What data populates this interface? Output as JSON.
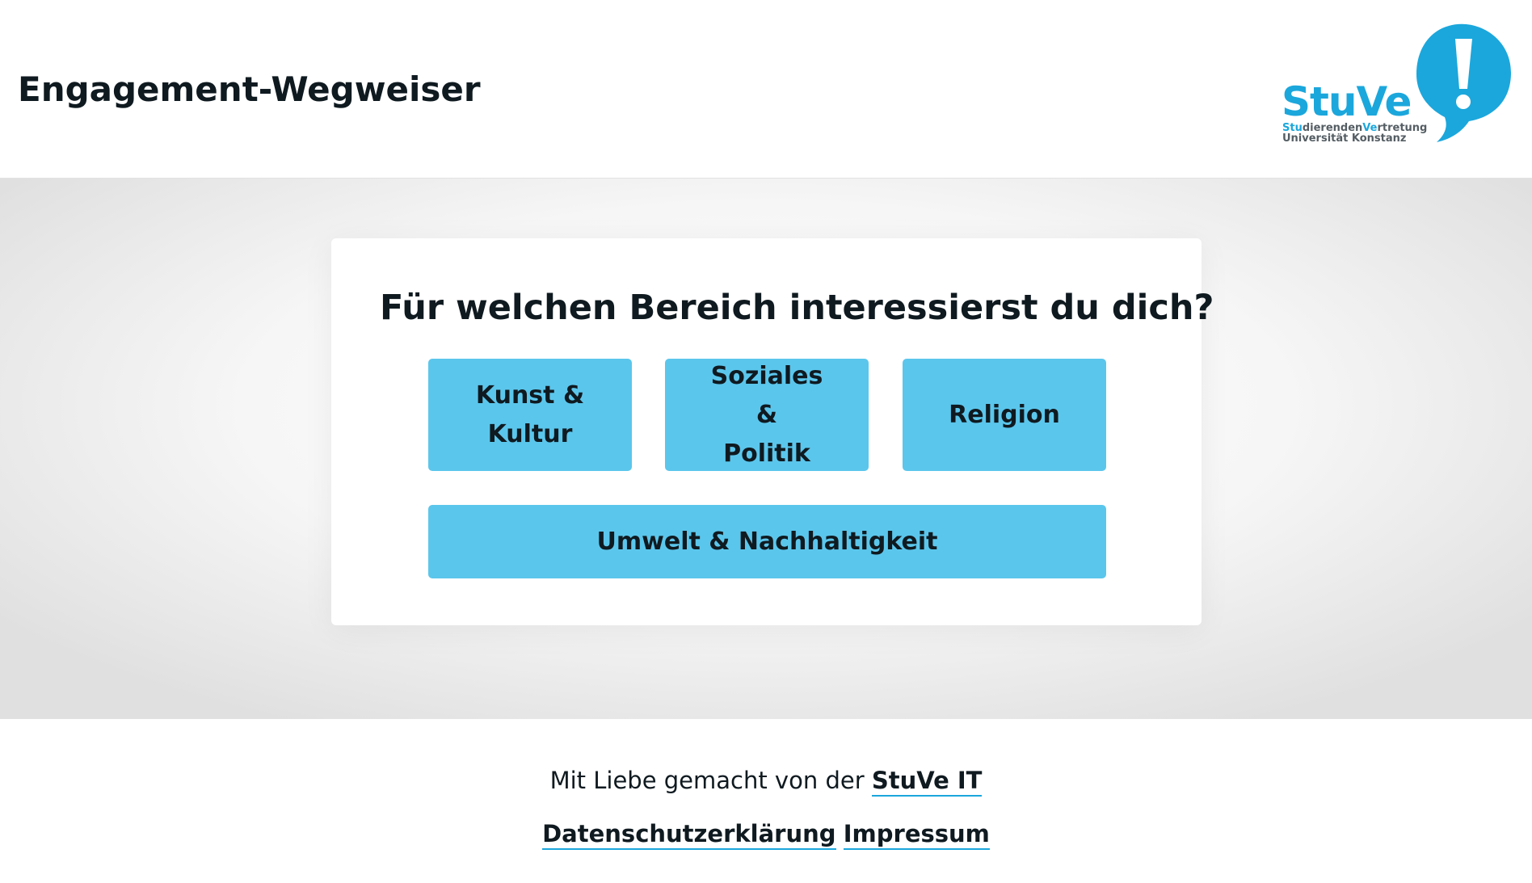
{
  "header": {
    "title": "Engagement-Wegweiser",
    "logo": {
      "word": "StuVe",
      "sub_line1_part1": "Stu",
      "sub_line1_part2": "dierenden",
      "sub_line1_part3": "Ve",
      "sub_line1_part4": "rtretung",
      "sub_line2": "Universität Konstanz",
      "accent_color": "#1ba7dc"
    }
  },
  "main": {
    "question": "Für welchen Bereich interessierst du dich?",
    "options": [
      {
        "line1": "Kunst &",
        "line2": "Kultur"
      },
      {
        "line1": "Soziales &",
        "line2": "Politik"
      },
      {
        "line1": "Religion",
        "line2": ""
      },
      {
        "line1": "Umwelt & Nachhaltigkeit",
        "line2": ""
      }
    ],
    "button_color": "#5bc6ec"
  },
  "footer": {
    "made_by_text": "Mit Liebe gemacht von der",
    "made_by_link": "StuVe IT",
    "privacy_link": "Datenschutzerklärung",
    "imprint_link": "Impressum"
  }
}
